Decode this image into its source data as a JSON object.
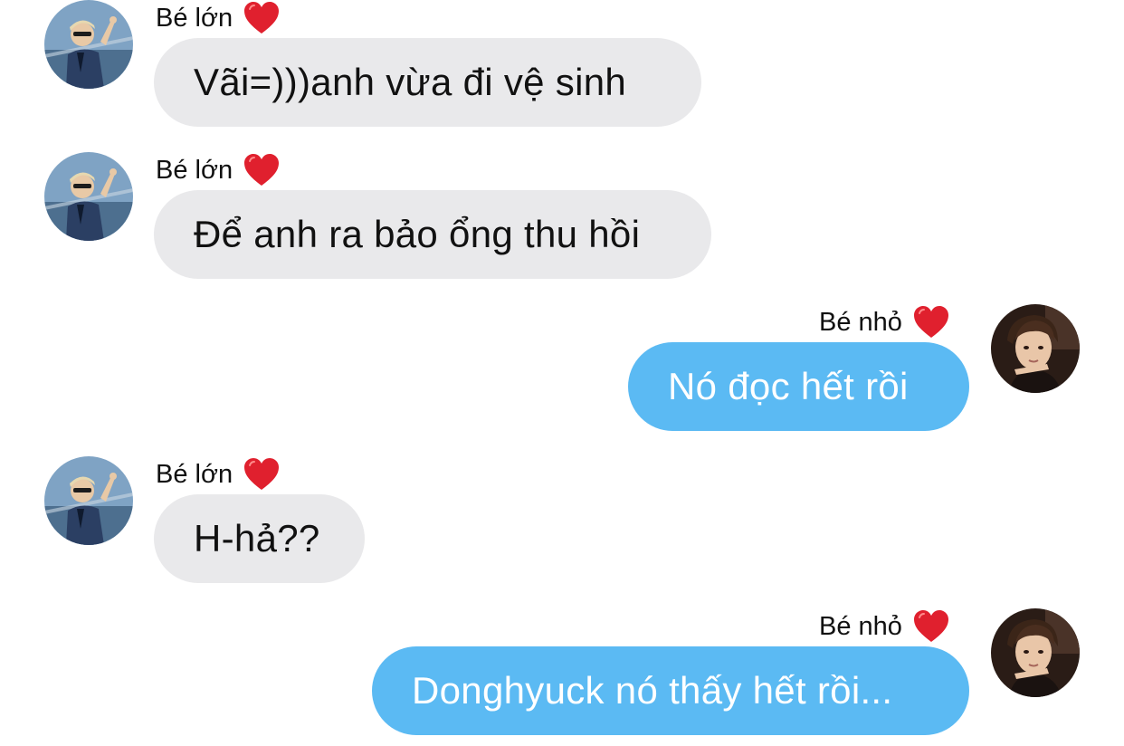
{
  "conversation": {
    "messages": [
      {
        "sender": "Bé lớn",
        "heart_icon": "red-heart-icon",
        "avatar_icon": "avatar-be-lon",
        "direction": "incoming",
        "text": "Vãi=)))anh vừa đi vệ sinh"
      },
      {
        "sender": "Bé lớn",
        "heart_icon": "red-heart-icon",
        "avatar_icon": "avatar-be-lon",
        "direction": "incoming",
        "text": "Để anh ra bảo ổng thu hồi"
      },
      {
        "sender": "Bé nhỏ",
        "heart_icon": "red-heart-icon",
        "avatar_icon": "avatar-be-nho",
        "direction": "outgoing",
        "text": "Nó đọc hết rồi"
      },
      {
        "sender": "Bé lớn",
        "heart_icon": "red-heart-icon",
        "avatar_icon": "avatar-be-lon",
        "direction": "incoming",
        "text": "H-hả??"
      },
      {
        "sender": "Bé nhỏ",
        "heart_icon": "red-heart-icon",
        "avatar_icon": "avatar-be-nho",
        "direction": "outgoing",
        "text": "Donghyuck nó thấy hết rồi..."
      }
    ]
  },
  "colors": {
    "incoming_bubble": "#e9e9eb",
    "outgoing_bubble": "#5bbaf3",
    "heart": "#e0202e",
    "background": "#ffffff"
  }
}
